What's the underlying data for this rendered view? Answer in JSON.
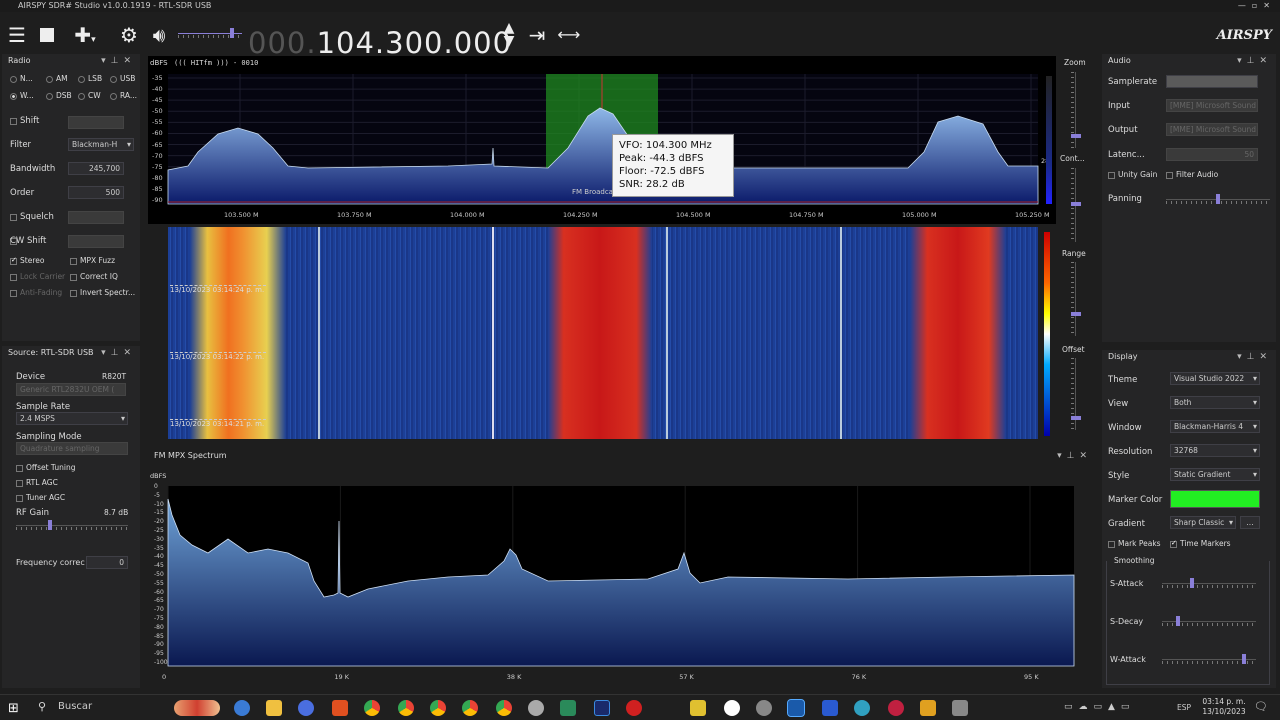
{
  "app": {
    "title": "AIRSPY SDR# Studio v1.0.0.1919 - RTL-SDR USB",
    "logo": "AIRSPY"
  },
  "toolbar": {
    "frequency_dim": "000.",
    "frequency_main": "104.300.000"
  },
  "radio": {
    "title": "Radio",
    "modes": [
      "N...",
      "AM",
      "LSB",
      "USB",
      "W...",
      "DSB",
      "CW",
      "RA..."
    ],
    "selected_mode": "W...",
    "shift_label": "Shift",
    "filter_label": "Filter",
    "filter_value": "Blackman-H",
    "bandwidth_label": "Bandwidth",
    "bandwidth_value": "245,700",
    "order_label": "Order",
    "order_value": "500",
    "squelch_label": "Squelch",
    "cwshift_label": "CW Shift",
    "stereo": "Stereo",
    "mpx_fuzz": "MPX Fuzz",
    "lock_carrier": "Lock Carrier",
    "correct_iq": "Correct IQ",
    "anti_fading": "Anti-Fading",
    "invert_spectrum": "Invert Spectr..."
  },
  "source": {
    "title": "Source: RTL-SDR USB",
    "device_label": "Device",
    "device_value": "R820T",
    "device_name": "Generic RTL2832U OEM (",
    "sample_rate_label": "Sample Rate",
    "sample_rate_value": "2.4 MSPS",
    "sampling_mode_label": "Sampling Mode",
    "sampling_mode_value": "Quadrature sampling",
    "offset_tuning": "Offset Tuning",
    "rtl_agc": "RTL AGC",
    "tuner_agc": "Tuner AGC",
    "rf_gain_label": "RF Gain",
    "rf_gain_value": "8.7 dB",
    "freq_corr_label": "Frequency correc",
    "freq_corr_value": "0",
    "rf_gain_fraction": 0.3
  },
  "spectrum": {
    "header_unit": "dBFS",
    "header_text": "(((   HITfm   ))) - 0010",
    "y_ticks": [
      "-35",
      "-40",
      "-45",
      "-50",
      "-55",
      "-60",
      "-65",
      "-70",
      "-75",
      "-80",
      "-85",
      "-90"
    ],
    "x_ticks": [
      "103.500 M",
      "103.750 M",
      "104.000 M",
      "104.250 M",
      "104.500 M",
      "104.750 M",
      "105.000 M",
      "105.250 M"
    ],
    "station_label": "FM Broadcast",
    "right_value": "28",
    "tooltip": {
      "vfo_label": "VFO:",
      "vfo_value": "104.300 MHz",
      "peak_label": "Peak:",
      "peak_value": "-44.3 dBFS",
      "floor_label": "Floor:",
      "floor_value": "-72.5 dBFS",
      "snr_label": "SNR:",
      "snr_value": "28.2 dB"
    },
    "zoom": "Zoom",
    "contrast": "Cont...",
    "range": "Range",
    "offset": "Offset"
  },
  "waterfall": {
    "timestamps": [
      "13/10/2023 03:14:24 p. m.",
      "13/10/2023 03:14:22 p. m.",
      "13/10/2023 03:14:21 p. m."
    ]
  },
  "mpx": {
    "title": "FM MPX Spectrum",
    "unit": "dBFS",
    "y_ticks": [
      "0",
      "-5",
      "-10",
      "-15",
      "-20",
      "-25",
      "-30",
      "-35",
      "-40",
      "-45",
      "-50",
      "-55",
      "-60",
      "-65",
      "-70",
      "-75",
      "-80",
      "-85",
      "-90",
      "-95",
      "-100"
    ],
    "x_ticks": [
      "0",
      "19 K",
      "38 K",
      "57 K",
      "76 K",
      "95 K"
    ]
  },
  "audio": {
    "title": "Audio",
    "samplerate_label": "Samplerate",
    "input_label": "Input",
    "input_value": "[MME] Microsoft Sound",
    "output_label": "Output",
    "output_value": "[MME] Microsoft Sound",
    "latency_label": "Latenc...",
    "latency_value": "50",
    "unity_gain": "Unity Gain",
    "filter_audio": "Filter Audio",
    "panning_label": "Panning",
    "panning_fraction": 0.5
  },
  "display": {
    "title": "Display",
    "theme_label": "Theme",
    "theme_value": "Visual Studio 2022",
    "view_label": "View",
    "view_value": "Both",
    "window_label": "Window",
    "window_value": "Blackman-Harris 4",
    "resolution_label": "Resolution",
    "resolution_value": "32768",
    "style_label": "Style",
    "style_value": "Static Gradient",
    "marker_color_label": "Marker Color",
    "marker_color": "#22ee22",
    "gradient_label": "Gradient",
    "gradient_value": "Sharp Classic",
    "gradient_btn": "...",
    "mark_peaks": "Mark Peaks",
    "time_markers": "Time Markers",
    "smoothing": "Smoothing",
    "s_attack": "S-Attack",
    "s_decay": "S-Decay",
    "w_attack": "W-Attack"
  },
  "taskbar": {
    "search": "Buscar",
    "lang": "ESP",
    "time": "03:14 p. m.",
    "date": "13/10/2023"
  }
}
